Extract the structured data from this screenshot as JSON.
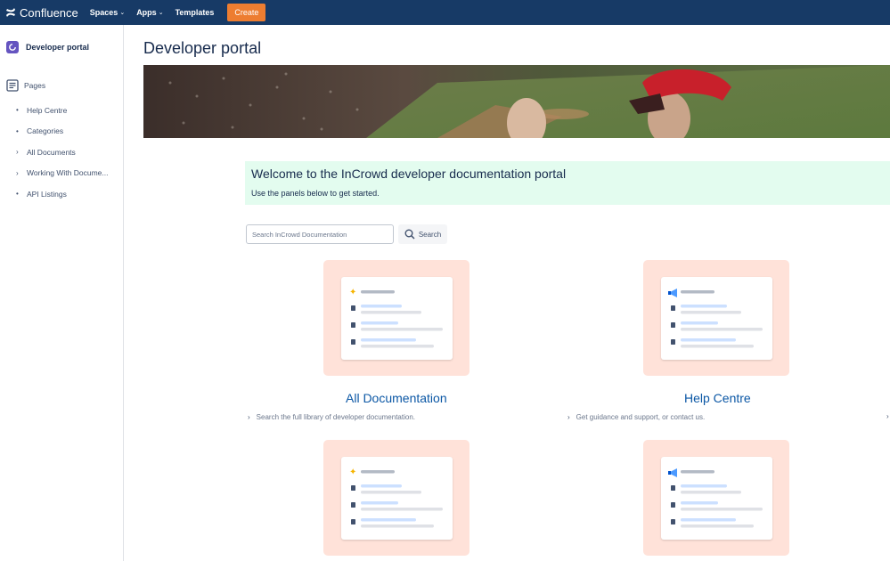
{
  "topnav": {
    "brand": "Confluence",
    "items": [
      {
        "label": "Spaces",
        "has_menu": true
      },
      {
        "label": "Apps",
        "has_menu": true
      },
      {
        "label": "Templates",
        "has_menu": false
      }
    ],
    "create_label": "Create",
    "colors": {
      "bar": "#173a66",
      "create": "#ed7d31"
    }
  },
  "sidebar": {
    "space_name": "Developer portal",
    "pages_label": "Pages",
    "tree": [
      {
        "label": "Help Centre",
        "marker": "•"
      },
      {
        "label": "Categories",
        "marker": "•"
      },
      {
        "label": "All Documents",
        "marker": "›"
      },
      {
        "label": "Working With Docume...",
        "marker": "›"
      },
      {
        "label": "API Listings",
        "marker": "•"
      }
    ]
  },
  "main": {
    "page_title": "Developer portal",
    "welcome": {
      "heading": "Welcome to the InCrowd developer documentation portal",
      "subtext": "Use the panels below to get started."
    },
    "search": {
      "placeholder": "Search InCrowd Documentation",
      "button_label": "Search"
    },
    "cards": [
      {
        "title": "All Documentation",
        "description": "Search the full library of developer documentation.",
        "icon": "sparkle-icon"
      },
      {
        "title": "Help Centre",
        "description": "Get guidance and support, or contact us.",
        "icon": "megaphone-icon"
      },
      {
        "title": "",
        "description": "",
        "icon": "sparkle-icon"
      },
      {
        "title": "",
        "description": "",
        "icon": "megaphone-icon"
      }
    ]
  }
}
